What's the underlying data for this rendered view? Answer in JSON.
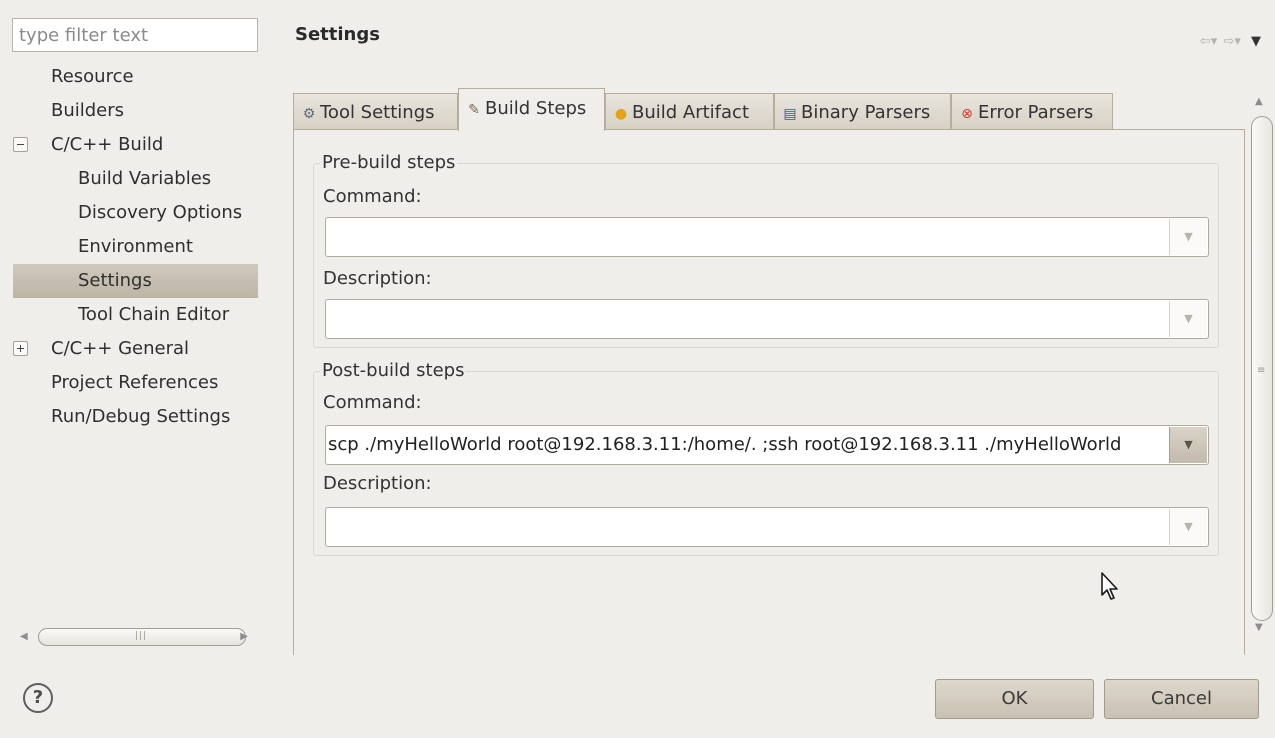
{
  "filter": {
    "placeholder": "type filter text"
  },
  "tree": {
    "items": [
      {
        "label": "Resource"
      },
      {
        "label": "Builders"
      },
      {
        "label": "C/C++ Build",
        "expander": "minus"
      },
      {
        "label": "Build Variables"
      },
      {
        "label": "Discovery Options"
      },
      {
        "label": "Environment"
      },
      {
        "label": "Settings",
        "selected": true
      },
      {
        "label": "Tool Chain Editor"
      },
      {
        "label": "C/C++ General",
        "expander": "plus"
      },
      {
        "label": "Project References"
      },
      {
        "label": "Run/Debug Settings"
      }
    ]
  },
  "page": {
    "title": "Settings"
  },
  "tabs": [
    {
      "label": "Tool Settings",
      "icon": "tool-settings-icon"
    },
    {
      "label": "Build Steps",
      "icon": "build-steps-icon",
      "active": true
    },
    {
      "label": "Build Artifact",
      "icon": "build-artifact-icon"
    },
    {
      "label": "Binary Parsers",
      "icon": "binary-parsers-icon"
    },
    {
      "label": "Error Parsers",
      "icon": "error-parsers-icon"
    }
  ],
  "pre_build": {
    "legend": "Pre-build steps",
    "command_label": "Command:",
    "command_value": "",
    "description_label": "Description:",
    "description_value": ""
  },
  "post_build": {
    "legend": "Post-build steps",
    "command_label": "Command:",
    "command_value": "scp ./myHelloWorld root@192.168.3.11:/home/. ;ssh root@192.168.3.11 ./myHelloWorld",
    "description_label": "Description:",
    "description_value": ""
  },
  "buttons": {
    "help_icon": "?",
    "ok": "OK",
    "cancel": "Cancel"
  },
  "colors": {
    "selection": "#c4bdb0",
    "background": "#f0eeea"
  }
}
